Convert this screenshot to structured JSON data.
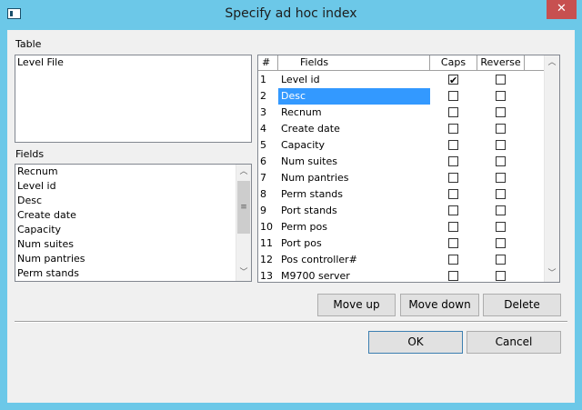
{
  "window": {
    "title": "Specify ad hoc index",
    "close_glyph": "✕"
  },
  "table_section": {
    "label": "Table",
    "items": [
      "Level File"
    ]
  },
  "fields_section": {
    "label": "Fields",
    "items": [
      "Recnum",
      "Level id",
      "Desc",
      "Create date",
      "Capacity",
      "Num suites",
      "Num pantries",
      "Perm stands"
    ]
  },
  "grid": {
    "columns": {
      "num": "#",
      "fields": "Fields",
      "caps": "Caps",
      "reverse": "Reverse"
    },
    "rows": [
      {
        "num": "1",
        "field": "Level id",
        "caps": true,
        "reverse": false,
        "selected": false
      },
      {
        "num": "2",
        "field": "Desc",
        "caps": false,
        "reverse": false,
        "selected": true
      },
      {
        "num": "3",
        "field": "Recnum",
        "caps": false,
        "reverse": false,
        "selected": false
      },
      {
        "num": "4",
        "field": "Create date",
        "caps": false,
        "reverse": false,
        "selected": false
      },
      {
        "num": "5",
        "field": "Capacity",
        "caps": false,
        "reverse": false,
        "selected": false
      },
      {
        "num": "6",
        "field": "Num suites",
        "caps": false,
        "reverse": false,
        "selected": false
      },
      {
        "num": "7",
        "field": "Num pantries",
        "caps": false,
        "reverse": false,
        "selected": false
      },
      {
        "num": "8",
        "field": "Perm stands",
        "caps": false,
        "reverse": false,
        "selected": false
      },
      {
        "num": "9",
        "field": "Port stands",
        "caps": false,
        "reverse": false,
        "selected": false
      },
      {
        "num": "10",
        "field": "Perm pos",
        "caps": false,
        "reverse": false,
        "selected": false
      },
      {
        "num": "11",
        "field": "Port pos",
        "caps": false,
        "reverse": false,
        "selected": false
      },
      {
        "num": "12",
        "field": "Pos controller#",
        "caps": false,
        "reverse": false,
        "selected": false
      },
      {
        "num": "13",
        "field": "M9700 server",
        "caps": false,
        "reverse": false,
        "selected": false
      }
    ]
  },
  "buttons": {
    "move_up": "Move up",
    "move_down": "Move down",
    "delete": "Delete",
    "ok": "OK",
    "cancel": "Cancel"
  },
  "colors": {
    "titlebar": "#6cc8e8",
    "close": "#c75050",
    "selection": "#3399ff"
  }
}
